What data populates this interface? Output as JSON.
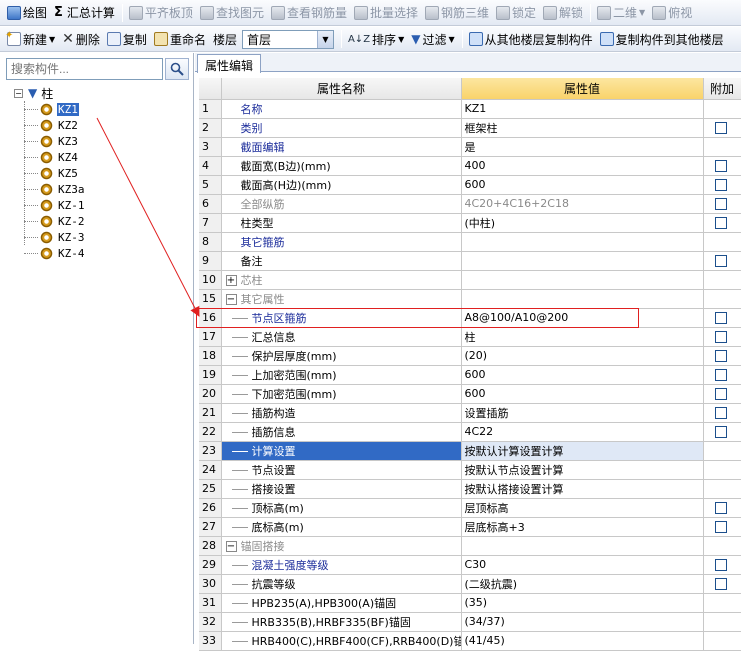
{
  "toolbar1": {
    "items": [
      {
        "label": "绘图",
        "icon": "pencil-icon",
        "enabled": true
      },
      {
        "label": "汇总计算",
        "icon": "sigma-icon",
        "enabled": true,
        "prefix": "Σ"
      },
      {
        "label": "平齐板顶",
        "icon": "align-icon",
        "enabled": false
      },
      {
        "label": "查找图元",
        "icon": "find-icon",
        "enabled": false
      },
      {
        "label": "查看钢筋量",
        "icon": "view-rebar-icon",
        "enabled": false
      },
      {
        "label": "批量选择",
        "icon": "batch-select-icon",
        "enabled": false
      },
      {
        "label": "钢筋三维",
        "icon": "rebar-3d-icon",
        "enabled": false
      },
      {
        "label": "锁定",
        "icon": "lock-icon",
        "enabled": false
      },
      {
        "label": "解锁",
        "icon": "unlock-icon",
        "enabled": false
      },
      {
        "label": "二维",
        "icon": "2d-icon",
        "enabled": false
      },
      {
        "label": "俯视",
        "icon": "topview-icon",
        "enabled": false
      }
    ]
  },
  "toolbar2": {
    "new_label": "新建",
    "delete_label": "删除",
    "copy_label": "复制",
    "rename_label": "重命名",
    "floor_label": "楼层",
    "floor_value": "首层",
    "sort_label": "排序",
    "filter_label": "过滤",
    "copy_from_label": "从其他楼层复制构件",
    "copy_to_label": "复制构件到其他楼层"
  },
  "search": {
    "placeholder": "搜索构件..."
  },
  "tree": {
    "root": "柱",
    "items": [
      "KZ1",
      "KZ2",
      "KZ3",
      "KZ4",
      "KZ5",
      "KZ3a",
      "KZ-1",
      "KZ-2",
      "KZ-3",
      "KZ-4"
    ],
    "selected": "KZ1"
  },
  "tab": {
    "label": "属性编辑"
  },
  "grid": {
    "headers": {
      "name": "属性名称",
      "value": "属性值",
      "extra": "附加"
    },
    "rows": [
      {
        "n": "1",
        "name": "名称",
        "value": "KZ1",
        "style": "blue",
        "level": 0,
        "chk": false
      },
      {
        "n": "2",
        "name": "类别",
        "value": "框架柱",
        "style": "blue",
        "level": 0,
        "chk": true
      },
      {
        "n": "3",
        "name": "截面编辑",
        "value": "是",
        "style": "blue",
        "level": 0,
        "chk": false
      },
      {
        "n": "4",
        "name": "截面宽(B边)(mm)",
        "value": "400",
        "style": "blk",
        "level": 0,
        "chk": true
      },
      {
        "n": "5",
        "name": "截面高(H边)(mm)",
        "value": "600",
        "style": "blk",
        "level": 0,
        "chk": true
      },
      {
        "n": "6",
        "name": "全部纵筋",
        "value": "4C20+4C16+2C18",
        "style": "gray",
        "level": 0,
        "chk": true
      },
      {
        "n": "7",
        "name": "柱类型",
        "value": "(中柱)",
        "style": "blk",
        "level": 0,
        "chk": true
      },
      {
        "n": "8",
        "name": "其它箍筋",
        "value": "",
        "style": "blue",
        "level": 0,
        "chk": false
      },
      {
        "n": "9",
        "name": "备注",
        "value": "",
        "style": "blk",
        "level": 0,
        "chk": true
      },
      {
        "n": "10",
        "name": "芯柱",
        "value": "",
        "style": "gray",
        "level": 0,
        "chk": false,
        "expander": "+"
      },
      {
        "n": "15",
        "name": "其它属性",
        "value": "",
        "style": "gray",
        "level": 0,
        "chk": false,
        "expander": "−"
      },
      {
        "n": "16",
        "name": "节点区箍筋",
        "value": "A8@100/A10@200",
        "style": "blue",
        "level": 1,
        "chk": true
      },
      {
        "n": "17",
        "name": "汇总信息",
        "value": "柱",
        "style": "blk",
        "level": 1,
        "chk": true
      },
      {
        "n": "18",
        "name": "保护层厚度(mm)",
        "value": "(20)",
        "style": "blk",
        "level": 1,
        "chk": true
      },
      {
        "n": "19",
        "name": "上加密范围(mm)",
        "value": "600",
        "style": "blk",
        "level": 1,
        "chk": true
      },
      {
        "n": "20",
        "name": "下加密范围(mm)",
        "value": "600",
        "style": "blk",
        "level": 1,
        "chk": true
      },
      {
        "n": "21",
        "name": "插筋构造",
        "value": "设置插筋",
        "style": "blk",
        "level": 1,
        "chk": true
      },
      {
        "n": "22",
        "name": "插筋信息",
        "value": "4C22",
        "style": "blk",
        "level": 1,
        "chk": true
      },
      {
        "n": "23",
        "name": "计算设置",
        "value": "按默认计算设置计算",
        "style": "blk",
        "level": 1,
        "chk": false,
        "highlight": true
      },
      {
        "n": "24",
        "name": "节点设置",
        "value": "按默认节点设置计算",
        "style": "blk",
        "level": 1,
        "chk": false
      },
      {
        "n": "25",
        "name": "搭接设置",
        "value": "按默认搭接设置计算",
        "style": "blk",
        "level": 1,
        "chk": false
      },
      {
        "n": "26",
        "name": "顶标高(m)",
        "value": "层顶标高",
        "style": "blk",
        "level": 1,
        "chk": true
      },
      {
        "n": "27",
        "name": "底标高(m)",
        "value": "层底标高+3",
        "style": "blk",
        "level": 1,
        "chk": true
      },
      {
        "n": "28",
        "name": "锚固搭接",
        "value": "",
        "style": "gray",
        "level": 0,
        "chk": false,
        "expander": "−"
      },
      {
        "n": "29",
        "name": "混凝土强度等级",
        "value": "C30",
        "style": "blue",
        "level": 1,
        "chk": true
      },
      {
        "n": "30",
        "name": "抗震等级",
        "value": "(二级抗震)",
        "style": "blk",
        "level": 1,
        "chk": true
      },
      {
        "n": "31",
        "name": "HPB235(A),HPB300(A)锚固",
        "value": "(35)",
        "style": "blk",
        "level": 1,
        "chk": false
      },
      {
        "n": "32",
        "name": "HRB335(B),HRBF335(BF)锚固",
        "value": "(34/37)",
        "style": "blk",
        "level": 1,
        "chk": false
      },
      {
        "n": "33",
        "name": "HRB400(C),HRBF400(CF),RRB400(D)锚",
        "value": "(41/45)",
        "style": "blk",
        "level": 1,
        "chk": false
      }
    ]
  },
  "colors": {
    "selection": "#316ac5",
    "header_value": "#f9d36b",
    "annotation": "#e02020"
  }
}
